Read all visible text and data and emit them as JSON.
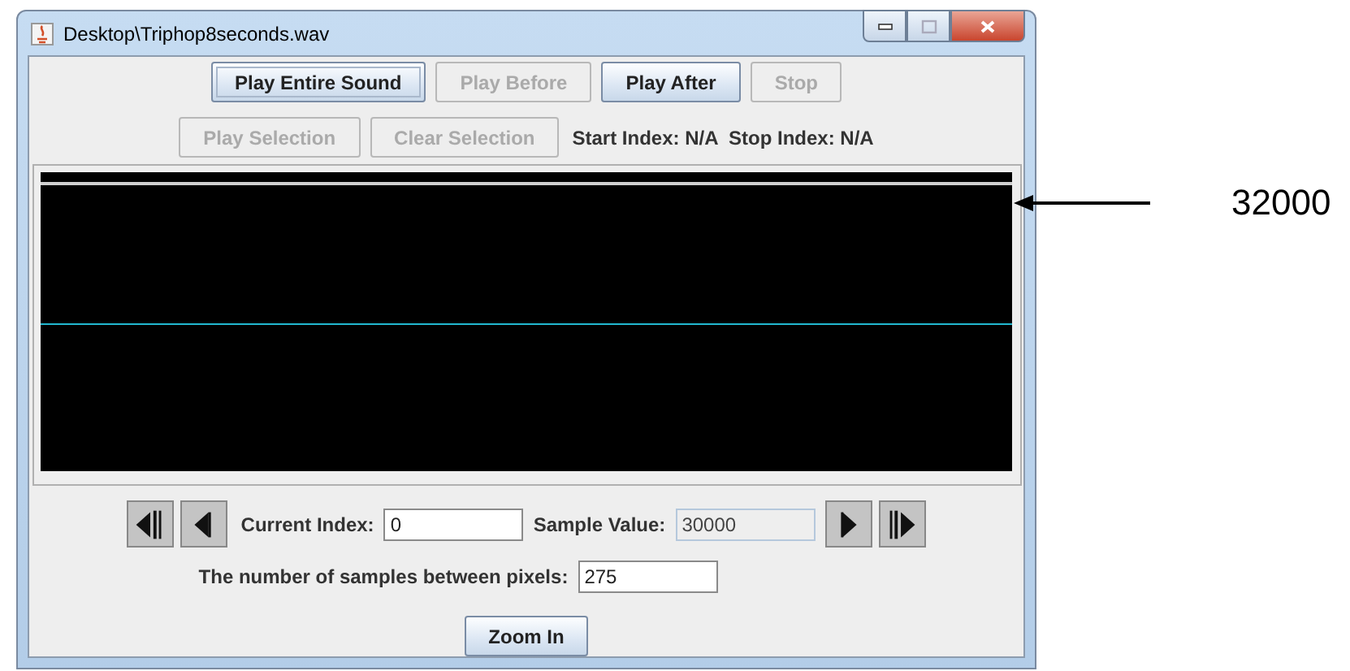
{
  "window": {
    "title": "Desktop\\Triphop8seconds.wav"
  },
  "play_buttons": [
    {
      "label": "Play Entire Sound",
      "disabled": false,
      "focused": true
    },
    {
      "label": "Play Before",
      "disabled": true,
      "focused": false
    },
    {
      "label": "Play After",
      "disabled": false,
      "focused": false
    },
    {
      "label": "Stop",
      "disabled": true,
      "focused": false
    }
  ],
  "selection_buttons": [
    {
      "label": "Play Selection",
      "disabled": true
    },
    {
      "label": "Clear Selection",
      "disabled": true
    }
  ],
  "selection_info": "Start Index: N/A  Stop Index: N/A",
  "navigation": [
    {
      "kind": "first"
    },
    {
      "kind": "previous"
    },
    {
      "kind": "field",
      "label": "Current Index:",
      "value": "0",
      "disabled": false
    },
    {
      "kind": "field",
      "label": "Sample Value:",
      "value": "30000",
      "disabled": true
    },
    {
      "kind": "next"
    },
    {
      "kind": "last"
    }
  ],
  "samples_field": {
    "label": "The number of samples between pixels:",
    "value": "275"
  },
  "zoom_button": {
    "label": "Zoom In"
  },
  "annotation": {
    "label": "32000"
  }
}
